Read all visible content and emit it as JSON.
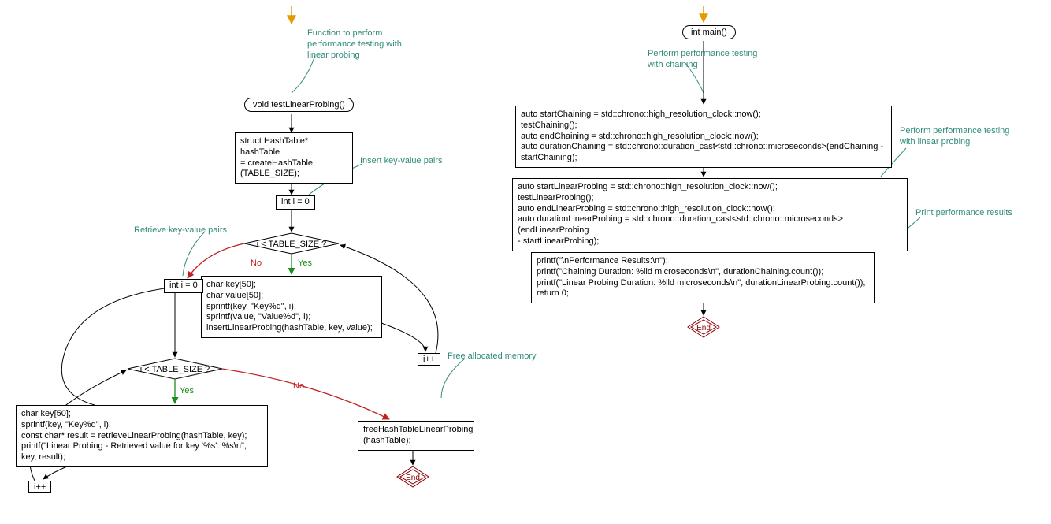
{
  "left": {
    "annot_fn": "Function to perform\nperformance testing with\nlinear probing",
    "terminal": "void testLinearProbing()",
    "create": "struct HashTable* hashTable\n= createHashTable\n(TABLE_SIZE);",
    "annot_insert": "Insert key-value pairs",
    "init0": "int i = 0",
    "annot_retrieve": "Retrieve key-value pairs",
    "cond0": "i < TABLE_SIZE ?",
    "no": "No",
    "yes": "Yes",
    "body0": "char key[50];\nchar value[50];\nsprintf(key, \"Key%d\", i);\nsprintf(value, \"Value%d\", i);\ninsertLinearProbing(hashTable, key, value);",
    "init1": "int i = 0",
    "annot_free": "Free allocated memory",
    "inc": "i++",
    "cond1": "i < TABLE_SIZE ?",
    "body1": "char key[50];\nsprintf(key, \"Key%d\", i);\nconst char* result = retrieveLinearProbing(hashTable, key);\nprintf(\"Linear Probing - Retrieved value for key '%s': %s\\n\", key, result);",
    "free": "freeHashTableLinearProbing\n(hashTable);",
    "end": "End"
  },
  "right": {
    "terminal": "int main()",
    "annot_chain": "Perform performance testing\nwith chaining",
    "b0": "auto startChaining = std::chrono::high_resolution_clock::now();\ntestChaining();\nauto endChaining = std::chrono::high_resolution_clock::now();\nauto durationChaining = std::chrono::duration_cast<std::chrono::microseconds>(endChaining -\nstartChaining);",
    "annot_lp": "Perform performance testing\nwith linear probing",
    "b1": "auto startLinearProbing = std::chrono::high_resolution_clock::now();\ntestLinearProbing();\nauto endLinearProbing = std::chrono::high_resolution_clock::now();\nauto durationLinearProbing = std::chrono::duration_cast<std::chrono::microseconds>(endLinearProbing\n- startLinearProbing);",
    "annot_print": "Print performance results",
    "b2": "printf(\"\\nPerformance Results:\\n\");\nprintf(\"Chaining Duration: %lld microseconds\\n\", durationChaining.count());\nprintf(\"Linear Probing Duration: %lld microseconds\\n\", durationLinearProbing.count());\nreturn 0;",
    "end": "End"
  }
}
